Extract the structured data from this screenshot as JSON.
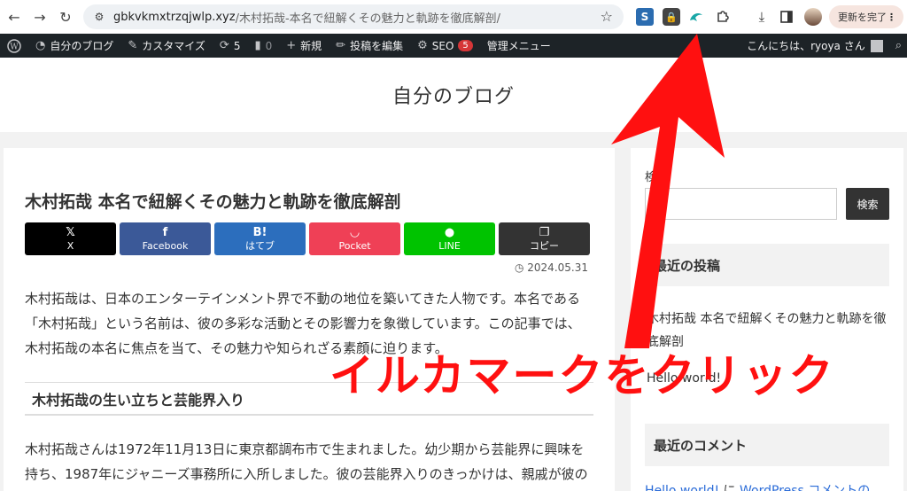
{
  "browser": {
    "url_host": "gbkvkmxtrzqjwlp.xyz",
    "url_path": "/木村拓哉-本名で紐解くその魅力と軌跡を徹底解剖/",
    "update_label": "更新を完了",
    "extensions": [
      "s-extension-icon",
      "lock-extension-icon",
      "dolphin-extension-icon",
      "puzzle-icon"
    ]
  },
  "adminbar": {
    "site_name": "自分のブログ",
    "customize": "カスタマイズ",
    "updates_count": "5",
    "comments_count": "0",
    "new_label": "新規",
    "edit_post": "投稿を編集",
    "seo_label": "SEO",
    "seo_count": "5",
    "admin_menu": "管理メニュー",
    "greeting": "こんにちは、ryoya さん"
  },
  "site": {
    "title": "自分のブログ"
  },
  "article": {
    "title": "木村拓哉 本名で紐解くその魅力と軌跡を徹底解剖",
    "share": [
      {
        "icon": "𝕏",
        "label": "X"
      },
      {
        "icon": "f",
        "label": "Facebook"
      },
      {
        "icon": "B!",
        "label": "はてブ"
      },
      {
        "icon": "◡",
        "label": "Pocket"
      },
      {
        "icon": "●",
        "label": "LINE"
      },
      {
        "icon": "❐",
        "label": "コピー"
      }
    ],
    "date": "2024.05.31",
    "para1": "木村拓哉は、日本のエンターテインメント界で不動の地位を築いてきた人物です。本名である「木村拓哉」という名前は、彼の多彩な活動とその影響力を象徴しています。この記事では、木村拓哉の本名に焦点を当て、その魅力や知られざる素顔に迫ります。",
    "h2": "木村拓哉の生い立ちと芸能界入り",
    "para2": "木村拓哉さんは1972年11月13日に東京都調布市で生まれました。幼少期から芸能界に興味を持ち、1987年にジャニーズ事務所に入所しました。彼の芸能界入りのきっかけは、親戚が彼の知"
  },
  "sidebar": {
    "search_label": "検",
    "search_button": "検索",
    "recent_posts_title": "最近の投稿",
    "recent_post_1": "木村拓哉 本名で紐解くその魅力と軌跡を徹底解剖",
    "recent_post_2": "Hello world!",
    "recent_comments_title": "最近のコメント",
    "comment_post": "Hello world!",
    "comment_sep": " に ",
    "comment_author": "WordPress コメントの"
  },
  "annotation": {
    "text": "イルカマークをクリック",
    "color": "#ff1010"
  }
}
